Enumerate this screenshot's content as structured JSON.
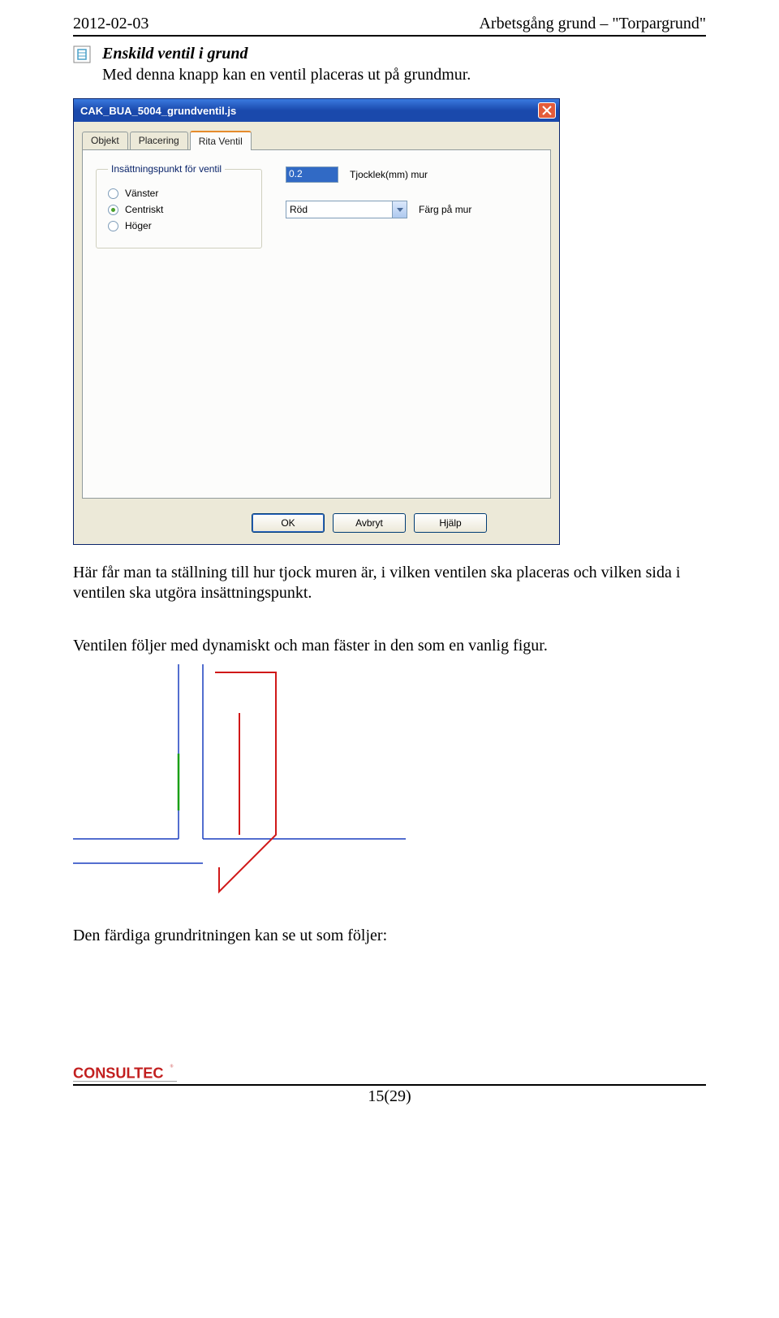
{
  "header": {
    "date": "2012-02-03",
    "doc_title": "Arbetsgång grund – \"Torpargrund\""
  },
  "section": {
    "heading": "Enskild ventil i grund",
    "intro": "Med denna knapp kan en ventil placeras ut på grundmur."
  },
  "dialog": {
    "title": "CAK_BUA_5004_grundventil.js",
    "tabs": {
      "t0": "Objekt",
      "t1": "Placering",
      "t2": "Rita Ventil"
    },
    "group_legend": "Insättningspunkt för ventil",
    "radios": {
      "r0": "Vänster",
      "r1": "Centriskt",
      "r2": "Höger"
    },
    "thickness": {
      "value": "0.2",
      "label": "Tjocklek(mm) mur"
    },
    "color": {
      "value": "Röd",
      "label": "Färg på mur"
    },
    "buttons": {
      "ok": "OK",
      "cancel": "Avbryt",
      "help": "Hjälp"
    }
  },
  "para": {
    "after_dialog": "Här får man ta ställning till hur tjock muren är, i vilken ventilen ska placeras och vilken sida i ventilen ska utgöra insättningspunkt.",
    "dynamic": "Ventilen följer med dynamiskt och man fäster in den som en vanlig figur.",
    "final": "Den färdiga grundritningen kan se ut som följer:"
  },
  "footer": {
    "logo_text": "CONSULTEC",
    "page": "15(29)"
  },
  "colors": {
    "xp_blue": "#1a49ac",
    "xp_close": "#e45c3a",
    "logo_red": "#c21f1f"
  }
}
